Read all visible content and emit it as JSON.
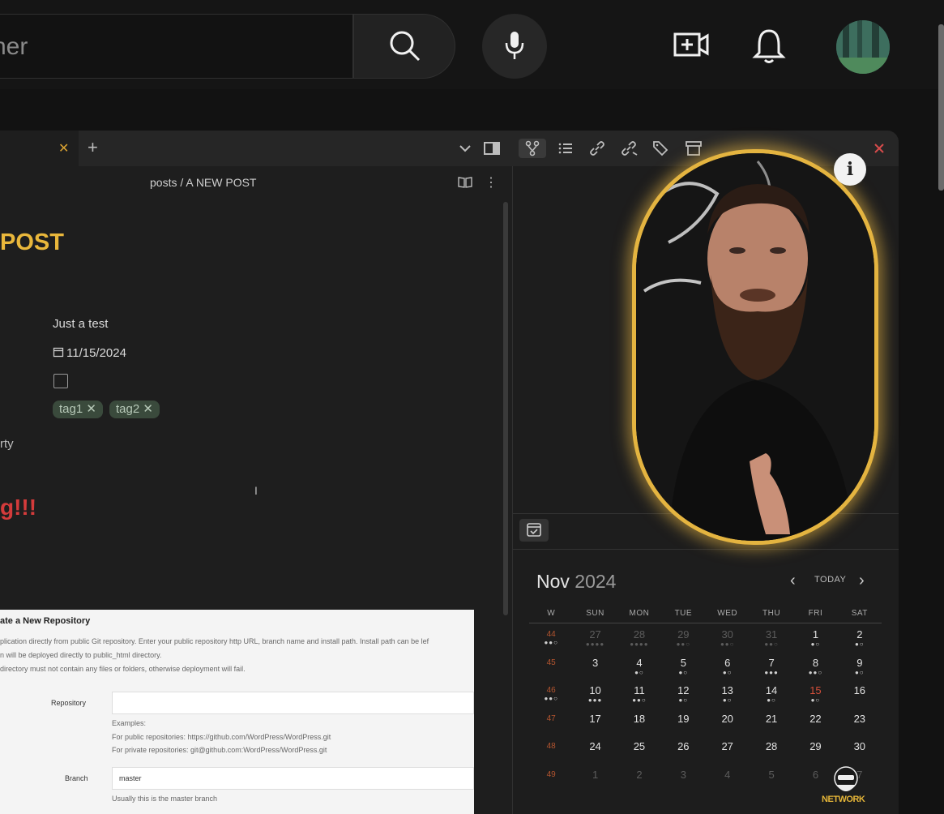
{
  "youtube": {
    "search_text": "ner",
    "icons": [
      "search-icon",
      "mic-icon",
      "create-video-icon",
      "bell-icon",
      "avatar"
    ]
  },
  "obsidian": {
    "tab_close": "✕",
    "new_tab": "+",
    "breadcrumb": "posts / A NEW POST",
    "heading": "POST",
    "properties": {
      "description": "Just a test",
      "date": "11/15/2024",
      "tags": [
        "tag1",
        "tag2"
      ],
      "add_property": "rty"
    },
    "red_text": "g!!!"
  },
  "embed": {
    "title": "ate a New Repository",
    "lines": [
      "plication directly from public Git repository. Enter your public repository http URL, branch name and install path. Install path can be lef",
      "n will be deployed directly to public_html directory.",
      " directory must not contain any files or folders, otherwise deployment will fail."
    ],
    "repository_label": "Repository",
    "examples": "Examples:",
    "public_example": "For public repositories: https://github.com/WordPress/WordPress.git",
    "private_example": "For private repositories: git@github.com:WordPress/WordPress.git",
    "branch_label": "Branch",
    "branch_value": "master",
    "branch_hint": "Usually this is the master branch"
  },
  "calendar": {
    "month": "Nov",
    "year": "2024",
    "today_label": "TODAY",
    "headers": [
      "W",
      "SUN",
      "MON",
      "TUE",
      "WED",
      "THU",
      "FRI",
      "SAT"
    ],
    "rows": [
      [
        {
          "d": "44",
          "w": true,
          "dots": "●●○"
        },
        {
          "d": "27",
          "dim": true,
          "dots": "●●●●"
        },
        {
          "d": "28",
          "dim": true,
          "dots": "●●●●"
        },
        {
          "d": "29",
          "dim": true,
          "dots": "●●○"
        },
        {
          "d": "30",
          "dim": true,
          "dots": "●●○"
        },
        {
          "d": "31",
          "dim": true,
          "dots": "●●○"
        },
        {
          "d": "1",
          "dots": "●○"
        },
        {
          "d": "2",
          "dots": "●○"
        }
      ],
      [
        {
          "d": "45",
          "w": true
        },
        {
          "d": "3"
        },
        {
          "d": "4",
          "dots": "●○"
        },
        {
          "d": "5",
          "dots": "●○"
        },
        {
          "d": "6",
          "dots": "●○"
        },
        {
          "d": "7",
          "dots": "●●●"
        },
        {
          "d": "8",
          "dots": "●●○"
        },
        {
          "d": "9",
          "dots": "●○"
        }
      ],
      [
        {
          "d": "46",
          "w": true,
          "dots": "●●○"
        },
        {
          "d": "10",
          "dots": "●●●"
        },
        {
          "d": "11",
          "dots": "●●○"
        },
        {
          "d": "12",
          "dots": "●○"
        },
        {
          "d": "13",
          "dots": "●○"
        },
        {
          "d": "14",
          "dots": "●○"
        },
        {
          "d": "15",
          "today": true,
          "dots": "●○"
        },
        {
          "d": "16"
        }
      ],
      [
        {
          "d": "47",
          "w": true
        },
        {
          "d": "17"
        },
        {
          "d": "18"
        },
        {
          "d": "19"
        },
        {
          "d": "20"
        },
        {
          "d": "21"
        },
        {
          "d": "22"
        },
        {
          "d": "23"
        }
      ],
      [
        {
          "d": "48",
          "w": true
        },
        {
          "d": "24"
        },
        {
          "d": "25"
        },
        {
          "d": "26"
        },
        {
          "d": "27"
        },
        {
          "d": "28"
        },
        {
          "d": "29"
        },
        {
          "d": "30"
        }
      ],
      [
        {
          "d": "49",
          "w": true
        },
        {
          "d": "1",
          "dim": true
        },
        {
          "d": "2",
          "dim": true
        },
        {
          "d": "3",
          "dim": true
        },
        {
          "d": "4",
          "dim": true
        },
        {
          "d": "5",
          "dim": true
        },
        {
          "d": "6",
          "dim": true
        },
        {
          "d": "7",
          "dim": true
        }
      ]
    ]
  },
  "webcam": {
    "info_label": "i"
  },
  "watermark": {
    "text": "NETWORK"
  }
}
